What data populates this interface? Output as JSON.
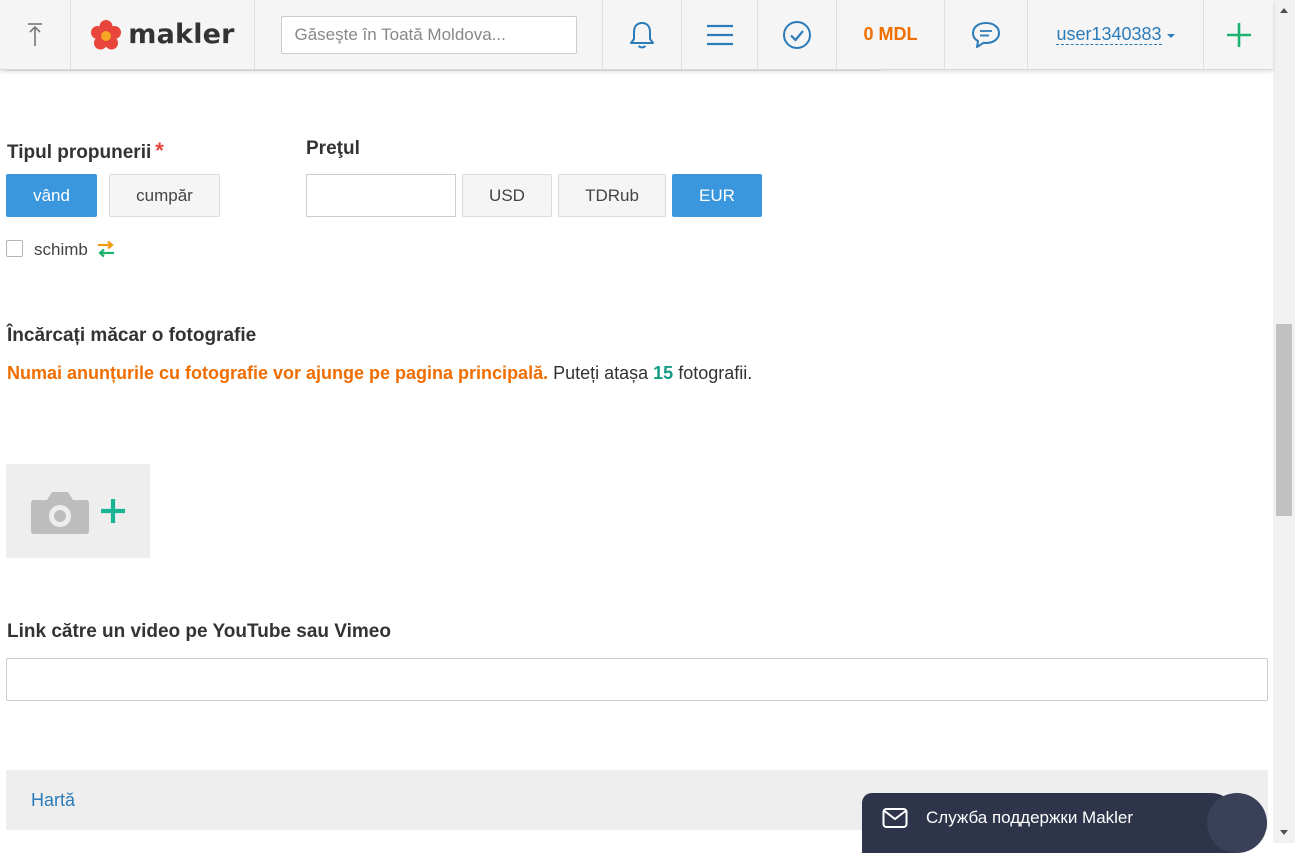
{
  "header": {
    "scroll_top_icon": "arrow-up-to-line-icon",
    "logo_text": "makler",
    "search_placeholder": "Găseşte în Toată Moldova...",
    "bell_icon": "bell-icon",
    "menu_icon": "hamburger-menu-icon",
    "check_icon": "check-circle-icon",
    "balance": "0 MDL",
    "chat_icon": "chat-bubble-icon",
    "username": "user1340383",
    "add_icon": "plus-icon"
  },
  "offer_type": {
    "label": "Tipul propunerii",
    "required_mark": "*",
    "options": [
      "vând",
      "cumpăr"
    ],
    "selected": "vând",
    "exchange_label": "schimb",
    "exchange_checked": false
  },
  "price": {
    "label": "Preţul",
    "value": "",
    "currencies": [
      "USD",
      "TDRub",
      "EUR"
    ],
    "selected_currency": "EUR"
  },
  "photos": {
    "title": "Încărcați măcar o fotografie",
    "notice_highlight": "Numai anunțurile cu fotografie vor ajunge pe pagina principală.",
    "notice_prefix": " Puteți atașa ",
    "max_count": "15",
    "notice_suffix": " fotografii."
  },
  "video": {
    "label": "Link către un video pe YouTube sau Vimeo",
    "value": ""
  },
  "map": {
    "label": "Hartă"
  },
  "support": {
    "label": "Служба поддержки Makler"
  },
  "colors": {
    "accent_blue": "#3a96dd",
    "link_blue": "#2b7bb9",
    "orange": "#f06d00",
    "green": "#1bb36f",
    "teal": "#139b84",
    "support_bg": "#2e3449"
  }
}
